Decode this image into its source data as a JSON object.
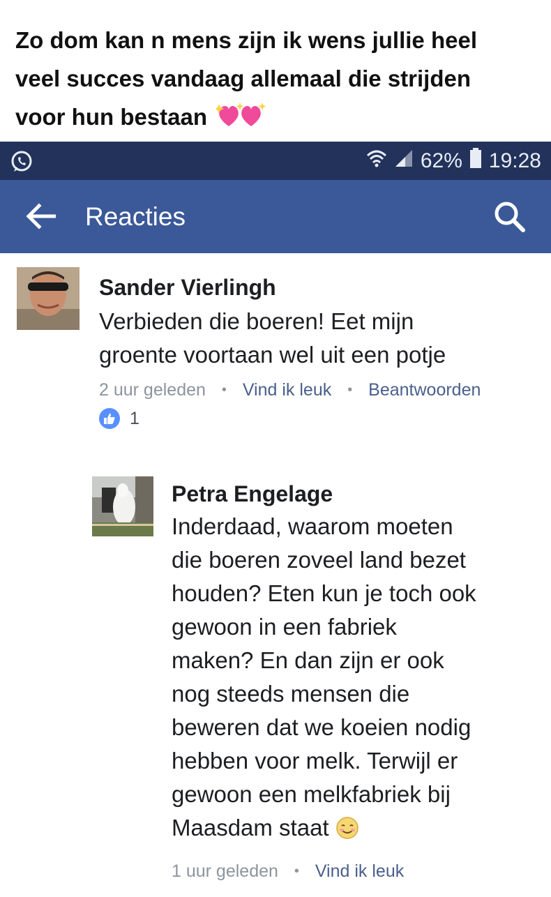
{
  "caption": {
    "line1": "Zo dom kan n mens zijn ik wens jullie heel",
    "line2": "veel succes vandaag allemaal die strijden",
    "line3": "voor hun bestaan",
    "emoji": "sparkling-heart-icon"
  },
  "statusbar": {
    "app_icon": "whatsapp-icon",
    "battery_percent": "62%",
    "time": "19:28",
    "icons": [
      "wifi-icon",
      "signal-icon",
      "battery-icon"
    ]
  },
  "appbar": {
    "back_icon": "arrow-left-icon",
    "title": "Reacties",
    "search_icon": "search-icon"
  },
  "colors": {
    "statusbar_bg": "#22325a",
    "appbar_bg": "#3b5998",
    "like_blue": "#5890ff",
    "meta_gray": "#8d949e",
    "meta_link": "#4a5f8c"
  },
  "comments": [
    {
      "author": "Sander Vierlingh",
      "lines": [
        "Verbieden die boeren! Eet mijn",
        "groente voortaan wel uit een potje"
      ],
      "time": "2 uur geleden",
      "like_label": "Vind ik leuk",
      "reply_label": "Beantwoorden",
      "reaction_count": "1"
    },
    {
      "author": "Petra Engelage",
      "lines": [
        "Inderdaad, waarom moeten",
        "die boeren zoveel land bezet",
        "houden? Eten kun je toch ook",
        "gewoon in een fabriek",
        "maken? En dan zijn er ook",
        "nog steeds mensen die",
        "beweren dat we koeien nodig",
        "hebben voor melk. Terwijl er",
        "gewoon een melkfabriek bij",
        "Maasdam staat"
      ],
      "emoji": "smiling-face-icon",
      "time": "1 uur geleden",
      "like_label": "Vind ik leuk"
    }
  ]
}
